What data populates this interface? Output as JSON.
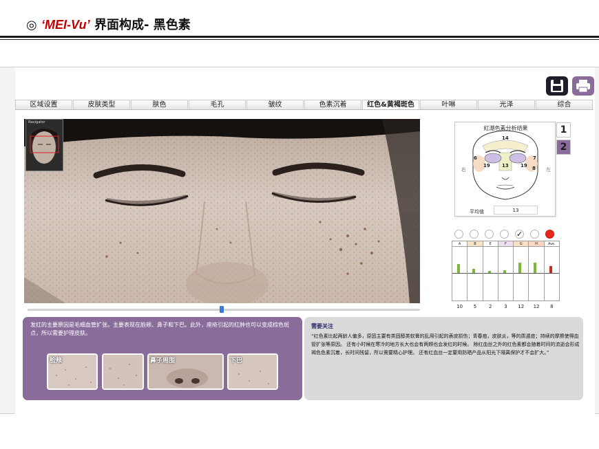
{
  "slide": {
    "symbol": "◎",
    "brand": "‘MEI-Vu’",
    "title_rest": " 界面构成- 黑色素"
  },
  "toolbar": {
    "save_icon": "save-icon",
    "print_icon": "printer-icon"
  },
  "tabs": [
    {
      "label": "区域设置",
      "active": false
    },
    {
      "label": "皮肤类型",
      "active": false
    },
    {
      "label": "肤色",
      "active": false
    },
    {
      "label": "毛孔",
      "active": false
    },
    {
      "label": "皱纹",
      "active": false
    },
    {
      "label": "色素沉着",
      "active": false
    },
    {
      "label": "红色&黄褐斑色",
      "active": true
    },
    {
      "label": "叶啉",
      "active": false
    },
    {
      "label": "光泽",
      "active": false
    },
    {
      "label": "综合",
      "active": false
    }
  ],
  "navigator": {
    "label": "Navigator"
  },
  "analysis": {
    "title": "紅潮色素分析结果",
    "side_right": "右",
    "side_left": "左",
    "zones": [
      "14",
      "6",
      "7",
      "19",
      "13",
      "19",
      "8"
    ],
    "avg_label": "平均值",
    "avg_value": "13",
    "pages": [
      "1",
      "2"
    ],
    "active_page": "2"
  },
  "radios": [
    {
      "checked": false,
      "color": "#ffffff"
    },
    {
      "checked": false,
      "color": "#ffffff"
    },
    {
      "checked": false,
      "color": "#ffffff"
    },
    {
      "checked": false,
      "color": "#ffffff"
    },
    {
      "checked": true,
      "mark": "✓",
      "color": "#ffffff"
    },
    {
      "checked": false,
      "color": "#ffffff"
    },
    {
      "checked": false,
      "color": "#e8261e"
    }
  ],
  "bars": {
    "columns": [
      "A",
      "B",
      "E",
      "F",
      "G",
      "H",
      "Ave."
    ],
    "column_colors": [
      "#ffffff",
      "#f4e3c4",
      "#ffffff",
      "#ece0ef",
      "#fbe0c6",
      "#fbd7c4",
      "#ffffff"
    ],
    "values": [
      10,
      5,
      2,
      3,
      12,
      12,
      8
    ],
    "value_labels": [
      "10",
      "5",
      "2",
      "3",
      "12",
      "12",
      "8"
    ],
    "bar_colors": [
      "#7cb83c",
      "#7cb83c",
      "#7cb83c",
      "#7cb83c",
      "#7cb83c",
      "#7cb83c",
      "#d0261d"
    ],
    "max": 30
  },
  "description": {
    "text": "发红的主要原因是毛细血管扩张。主要表现在脸颊、鼻子和下巴。此外，座疮引起的红肿也可以变成棕色斑点，所以需要护理皮肤。",
    "thumbs": [
      "脸颊",
      "",
      "鼻子周围",
      "下巴"
    ]
  },
  "notes": {
    "title": "需要关注",
    "text": "“红色素比起两龄人偏多，原因主要有类固醇类软膏的乱用引起的表皮损伤；青春痘，皮肤炎，等的质遁症；持续的摩擦使得血管扩张等原因。 还有小时候在寒冷的地方长大也会有两颊也会发红的时候。 除红血丝之外的红色素都会随着时间的流逝会形成褐色色素沉着，长时间残留，所以需要精心护理。 还有红血丝一定要用防晒产品从阳光下隔离保护才不会扩大。”"
  }
}
